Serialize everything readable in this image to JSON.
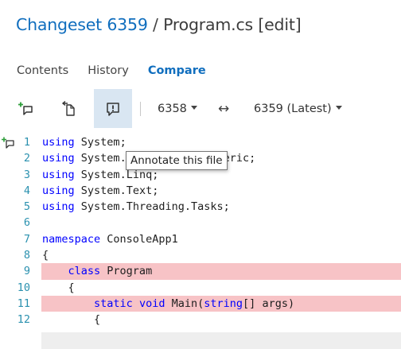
{
  "breadcrumb": {
    "changeset_link": "Changeset 6359",
    "separator": " / ",
    "file_name": "Program.cs [edit]"
  },
  "tabs": [
    {
      "label": "Contents",
      "active": false
    },
    {
      "label": "History",
      "active": false
    },
    {
      "label": "Compare",
      "active": true
    }
  ],
  "toolbar": {
    "buttons": [
      {
        "icon": "add-comment-icon"
      },
      {
        "icon": "go-to-file-icon"
      },
      {
        "icon": "annotate-icon",
        "active": true
      }
    ],
    "from_version": "6358",
    "swap_symbol": "↔",
    "to_version": "6359 (Latest)"
  },
  "tooltip": "Annotate this file",
  "code_lines": [
    {
      "n": "1",
      "text": "using System;",
      "change": "none"
    },
    {
      "n": "2",
      "text": "using System.Collections.Generic;",
      "change": "none"
    },
    {
      "n": "3",
      "text": "using System.Linq;",
      "change": "none"
    },
    {
      "n": "4",
      "text": "using System.Text;",
      "change": "none"
    },
    {
      "n": "5",
      "text": "using System.Threading.Tasks;",
      "change": "none"
    },
    {
      "n": "6",
      "text": "",
      "change": "none"
    },
    {
      "n": "7",
      "text": "namespace ConsoleApp1",
      "change": "none"
    },
    {
      "n": "8",
      "text": "{",
      "change": "none"
    },
    {
      "n": "9",
      "text": "    class Program",
      "change": "removed"
    },
    {
      "n": "10",
      "text": "    {",
      "change": "none"
    },
    {
      "n": "11",
      "text": "        static void Main(string[] args)",
      "change": "removed"
    },
    {
      "n": "12",
      "text": "        {",
      "change": "none"
    }
  ],
  "colors": {
    "link": "#106ebe",
    "keyword": "#0000ff",
    "line_number": "#2b91af",
    "removed_line": "#f7c3c6",
    "active_button": "#d9e6f2"
  }
}
